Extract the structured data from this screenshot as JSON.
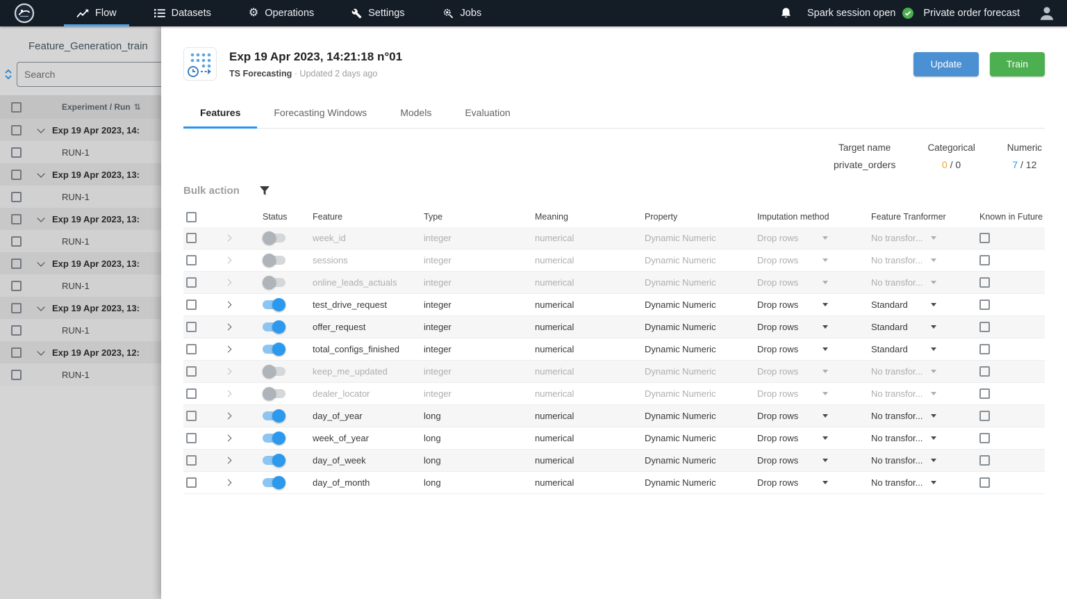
{
  "topbar": {
    "nav": [
      {
        "label": "Flow",
        "active": true
      },
      {
        "label": "Datasets",
        "active": false
      },
      {
        "label": "Operations",
        "active": false
      },
      {
        "label": "Settings",
        "active": false
      },
      {
        "label": "Jobs",
        "active": false
      }
    ],
    "session_status": "Spark session open",
    "project": "Private order forecast"
  },
  "sidebar": {
    "title": "Feature_Generation_train",
    "search_placeholder": "Search",
    "column_header": "Experiment / Run",
    "rows": [
      {
        "label": "Exp 19 Apr 2023, 14:",
        "type": "exp"
      },
      {
        "label": "RUN-1",
        "type": "run"
      },
      {
        "label": "Exp 19 Apr 2023, 13:",
        "type": "exp"
      },
      {
        "label": "RUN-1",
        "type": "run"
      },
      {
        "label": "Exp 19 Apr 2023, 13:",
        "type": "exp"
      },
      {
        "label": "RUN-1",
        "type": "run"
      },
      {
        "label": "Exp 19 Apr 2023, 13:",
        "type": "exp"
      },
      {
        "label": "RUN-1",
        "type": "run"
      },
      {
        "label": "Exp 19 Apr 2023, 13:",
        "type": "exp"
      },
      {
        "label": "RUN-1",
        "type": "run"
      },
      {
        "label": "Exp 19 Apr 2023, 12:",
        "type": "exp"
      },
      {
        "label": "RUN-1",
        "type": "run"
      }
    ]
  },
  "main": {
    "header": {
      "title": "Exp 19 Apr 2023, 14:21:18 n°01",
      "app_name": "TS Forecasting",
      "updated": "· Updated 2 days ago",
      "update_label": "Update",
      "train_label": "Train"
    },
    "tabs": [
      {
        "label": "Features",
        "active": true
      },
      {
        "label": "Forecasting Windows",
        "active": false
      },
      {
        "label": "Models",
        "active": false
      },
      {
        "label": "Evaluation",
        "active": false
      }
    ],
    "stats": {
      "target_label": "Target name",
      "target_value": "private_orders",
      "categorical_label": "Categorical",
      "categorical_count": "0",
      "categorical_total": " / 0",
      "numeric_label": "Numeric",
      "numeric_count": "7",
      "numeric_total": " / 12"
    },
    "bulk_action_label": "Bulk action",
    "table": {
      "headers": [
        "Status",
        "Feature",
        "Type",
        "Meaning",
        "Property",
        "Imputation method",
        "Feature Tranformer",
        "Known in Future"
      ],
      "rows": [
        {
          "feature": "week_id",
          "type": "integer",
          "meaning": "numerical",
          "property": "Dynamic Numeric",
          "imputation": "Drop rows",
          "transformer": "No transfor...",
          "enabled": false
        },
        {
          "feature": "sessions",
          "type": "integer",
          "meaning": "numerical",
          "property": "Dynamic Numeric",
          "imputation": "Drop rows",
          "transformer": "No transfor...",
          "enabled": false
        },
        {
          "feature": "online_leads_actuals",
          "type": "integer",
          "meaning": "numerical",
          "property": "Dynamic Numeric",
          "imputation": "Drop rows",
          "transformer": "No transfor...",
          "enabled": false
        },
        {
          "feature": "test_drive_request",
          "type": "integer",
          "meaning": "numerical",
          "property": "Dynamic Numeric",
          "imputation": "Drop rows",
          "transformer": "Standard",
          "enabled": true
        },
        {
          "feature": "offer_request",
          "type": "integer",
          "meaning": "numerical",
          "property": "Dynamic Numeric",
          "imputation": "Drop rows",
          "transformer": "Standard",
          "enabled": true
        },
        {
          "feature": "total_configs_finished",
          "type": "integer",
          "meaning": "numerical",
          "property": "Dynamic Numeric",
          "imputation": "Drop rows",
          "transformer": "Standard",
          "enabled": true
        },
        {
          "feature": "keep_me_updated",
          "type": "integer",
          "meaning": "numerical",
          "property": "Dynamic Numeric",
          "imputation": "Drop rows",
          "transformer": "No transfor...",
          "enabled": false
        },
        {
          "feature": "dealer_locator",
          "type": "integer",
          "meaning": "numerical",
          "property": "Dynamic Numeric",
          "imputation": "Drop rows",
          "transformer": "No transfor...",
          "enabled": false
        },
        {
          "feature": "day_of_year",
          "type": "long",
          "meaning": "numerical",
          "property": "Dynamic Numeric",
          "imputation": "Drop rows",
          "transformer": "No transfor...",
          "enabled": true
        },
        {
          "feature": "week_of_year",
          "type": "long",
          "meaning": "numerical",
          "property": "Dynamic Numeric",
          "imputation": "Drop rows",
          "transformer": "No transfor...",
          "enabled": true
        },
        {
          "feature": "day_of_week",
          "type": "long",
          "meaning": "numerical",
          "property": "Dynamic Numeric",
          "imputation": "Drop rows",
          "transformer": "No transfor...",
          "enabled": true
        },
        {
          "feature": "day_of_month",
          "type": "long",
          "meaning": "numerical",
          "property": "Dynamic Numeric",
          "imputation": "Drop rows",
          "transformer": "No transfor...",
          "enabled": true
        }
      ]
    }
  },
  "colors": {
    "accent_blue": "#2196f3",
    "update_blue": "#4a90d2",
    "train_green": "#4caf50",
    "amber": "#f0a330",
    "topbar_bg": "#141c26"
  }
}
